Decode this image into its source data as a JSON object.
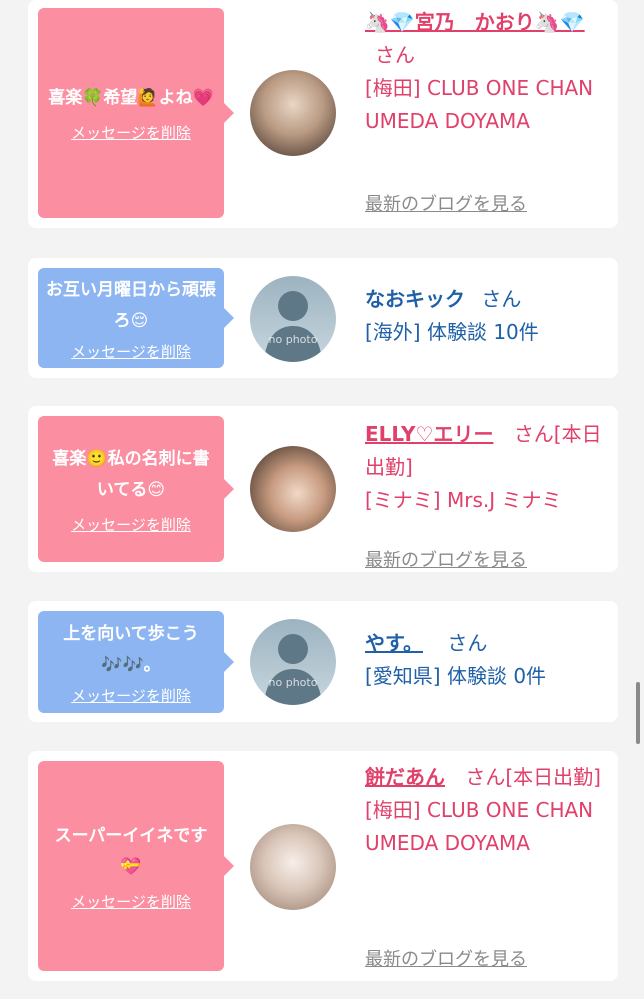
{
  "delete_label": "メッセージを削除",
  "blog_label": "最新のブログを見る",
  "colors": {
    "pink": "#fb8fa1",
    "blue": "#8db5f2",
    "name_pink": "#e0406a",
    "name_blue": "#2060a8"
  },
  "items": [
    {
      "message": "喜楽🍀希望🙋よね💗",
      "name": "🦄💎宮乃　かおり🦄💎",
      "honorific": "さん",
      "location": "[梅田] CLUB ONE CHAN UMEDA DOYAMA",
      "avatar": "photo"
    },
    {
      "message": "お互い月曜日から頑張ろ😌",
      "name": "なおキック",
      "honorific": "さん",
      "location": "[海外] 体験談 10件",
      "avatar": "no photo"
    },
    {
      "message": "喜楽🙂私の名刺に書いてる😊",
      "name": "ELLY♡エリー",
      "honorific": "さん[本日出勤]",
      "location": "[ミナミ] Mrs.J ミナミ",
      "avatar": "photo"
    },
    {
      "message": "上を向いて歩こう🎶🎶。",
      "name": "やす。",
      "honorific": "さん",
      "location": "[愛知県] 体験談 0件",
      "avatar": "no photo"
    },
    {
      "message": "スーパーイイネです💝",
      "name": "餅だあん",
      "honorific": "さん[本日出勤]",
      "location": "[梅田] CLUB ONE CHAN UMEDA DOYAMA",
      "avatar": "photo"
    }
  ]
}
